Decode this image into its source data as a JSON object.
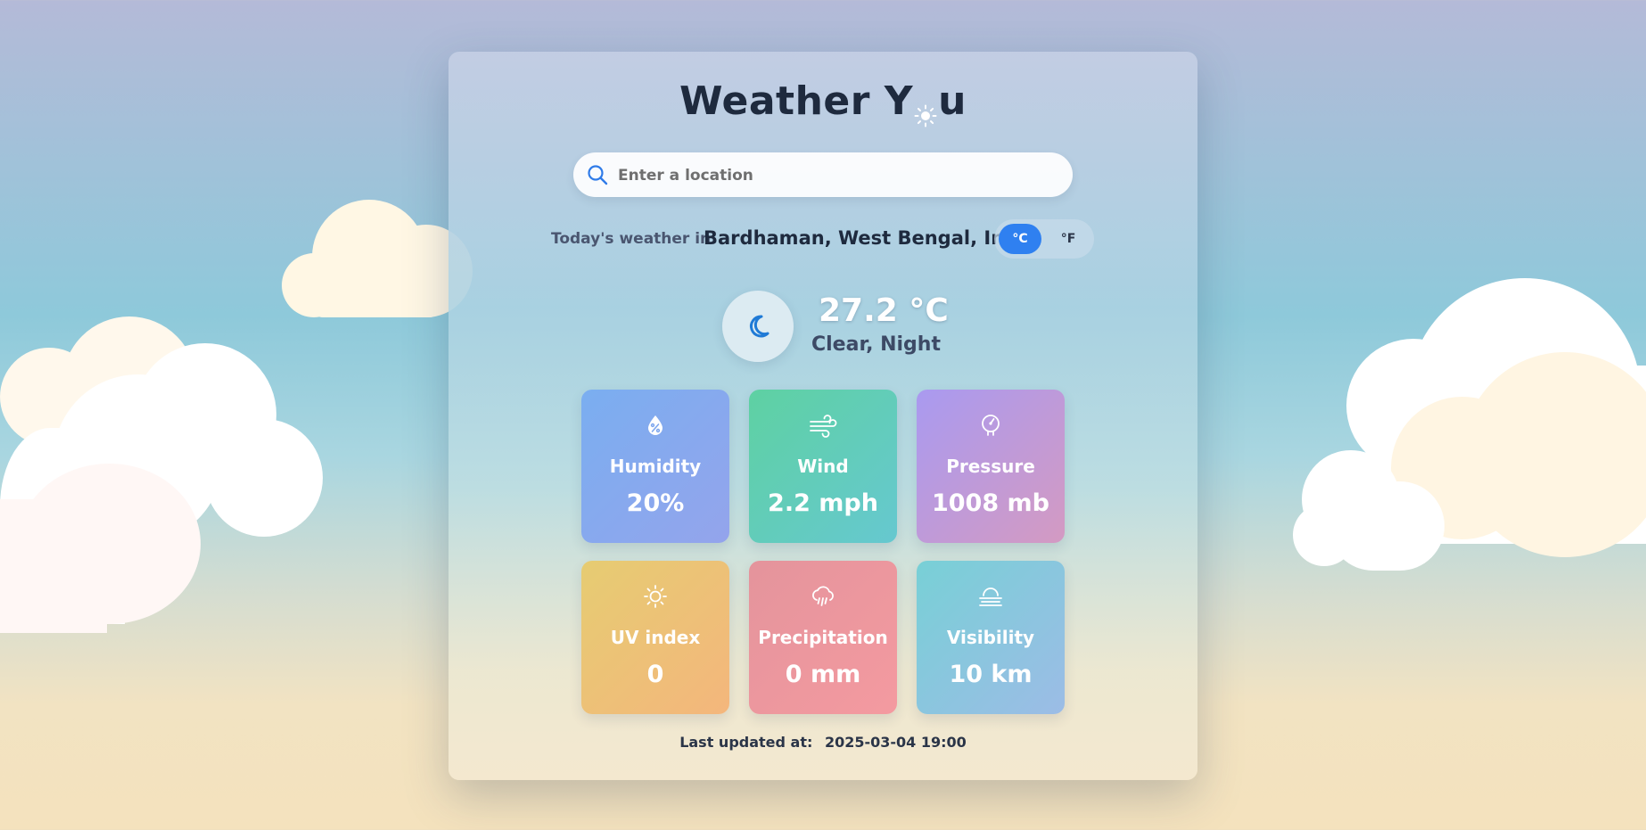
{
  "app": {
    "title_start": "Weather Y",
    "title_end": "u",
    "title_logo_icon": "sun-icon"
  },
  "search": {
    "placeholder": "Enter a location",
    "value": "",
    "icon": "search-icon"
  },
  "location": {
    "prefix": "Today's weather in",
    "name": "Bardhaman, West Bengal, India"
  },
  "units": {
    "celsius_label": "°C",
    "fahrenheit_label": "°F",
    "selected": "°C",
    "active_color": "#2f80f0"
  },
  "current": {
    "temperature": "27.2 °C",
    "condition": "Clear, Night",
    "icon": "moon-icon"
  },
  "metrics": [
    {
      "label": "Humidity",
      "value": "20%",
      "icon": "humidity-drop-icon"
    },
    {
      "label": "Wind",
      "value": "2.2 mph",
      "icon": "wind-icon"
    },
    {
      "label": "Pressure",
      "value": "1008 mb",
      "icon": "pressure-gauge-icon"
    },
    {
      "label": "UV index",
      "value": "0",
      "icon": "sun-icon"
    },
    {
      "label": "Precipitation",
      "value": "0 mm",
      "icon": "rain-cloud-icon"
    },
    {
      "label": "Visibility",
      "value": "10 km",
      "icon": "fog-icon"
    }
  ],
  "footer": {
    "updated_label": "Last updated at:",
    "updated_value": "2025-03-04 19:00"
  }
}
